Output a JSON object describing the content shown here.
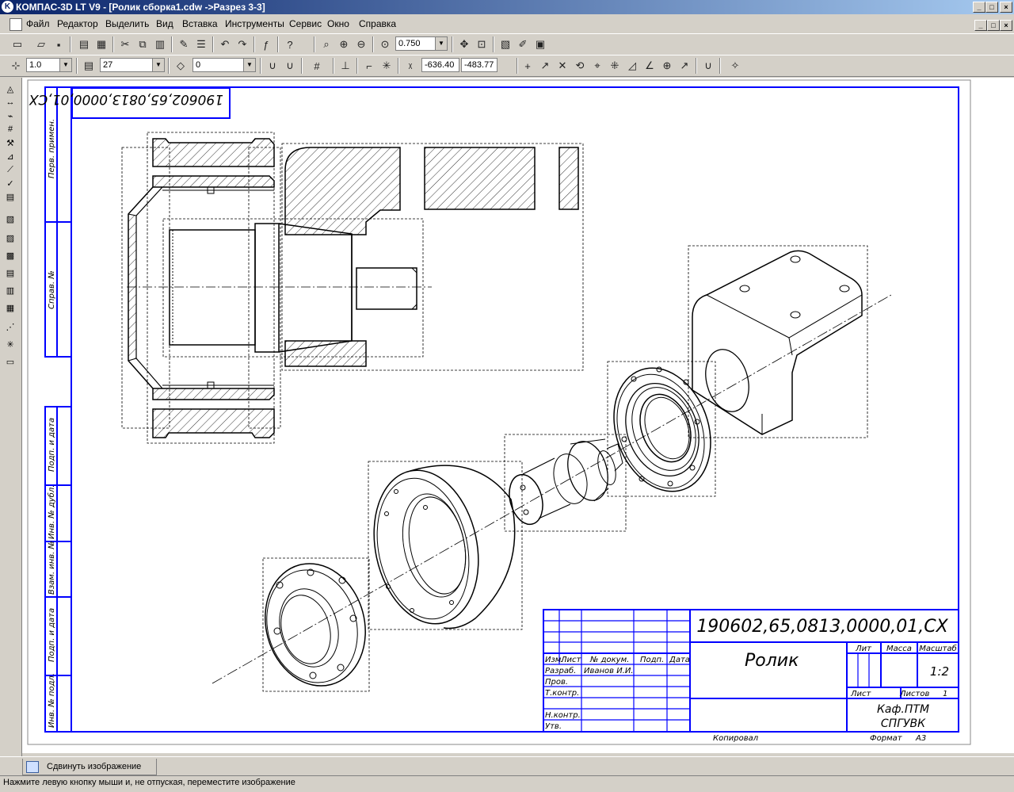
{
  "window": {
    "title": "КОМПАС-3D LT V9 - [Ролик сборка1.cdw ->Разрез 3-3]",
    "logo_glyph": "K",
    "min": "_",
    "max": "□",
    "close": "×"
  },
  "menu": {
    "items": [
      "Файл",
      "Редактор",
      "Выделить",
      "Вид",
      "Вставка",
      "Инструменты",
      "Сервис",
      "Окно",
      "Справка"
    ]
  },
  "toolbar1": {
    "zoom_value": "0.750"
  },
  "toolbar2": {
    "line_scale": "1.0",
    "layer": "27",
    "style": "0",
    "coord_x": "-636.40",
    "coord_y": "-483.77"
  },
  "drawing": {
    "rotated_designation": "190602,65,0813,0000,01,CX",
    "side_labels": [
      "Перв. примен.",
      "Справ. №",
      "Подп. и дата",
      "Инв. № дубл.",
      "Взам. инв. №",
      "Подп. и дата",
      "Инв. № подл."
    ],
    "title_block": {
      "designation": "190602,65,0813,0000,01,CX",
      "name": "Ролик",
      "lit_header": "Лит",
      "mass_header": "Масса",
      "scale_header": "Масштаб",
      "scale_value": "1:2",
      "sheet_label": "Лист",
      "sheets_label": "Листов",
      "sheets_value": "1",
      "org_line1": "Каф.ПТМ",
      "org_line2": "СПГУВК",
      "col_headers": [
        "Изм.",
        "Лист",
        "№ докум.",
        "Подп.",
        "Дата"
      ],
      "rows": [
        "Разраб.",
        "Пров.",
        "Т.контр.",
        "",
        "Н.контр.",
        "Утв."
      ],
      "developer": "Иванов И.И.",
      "copied": "Копировал",
      "format_label": "Формат",
      "format_value": "А3"
    }
  },
  "status": {
    "tab_label": "Сдвинуть изображение",
    "hint": "Нажмите левую кнопку мыши и, не отпуская, переместите изображение"
  },
  "colors": {
    "frame_blue": "#0000ff",
    "title_bar_start": "#0a246a",
    "title_bar_end": "#a6caf0"
  }
}
